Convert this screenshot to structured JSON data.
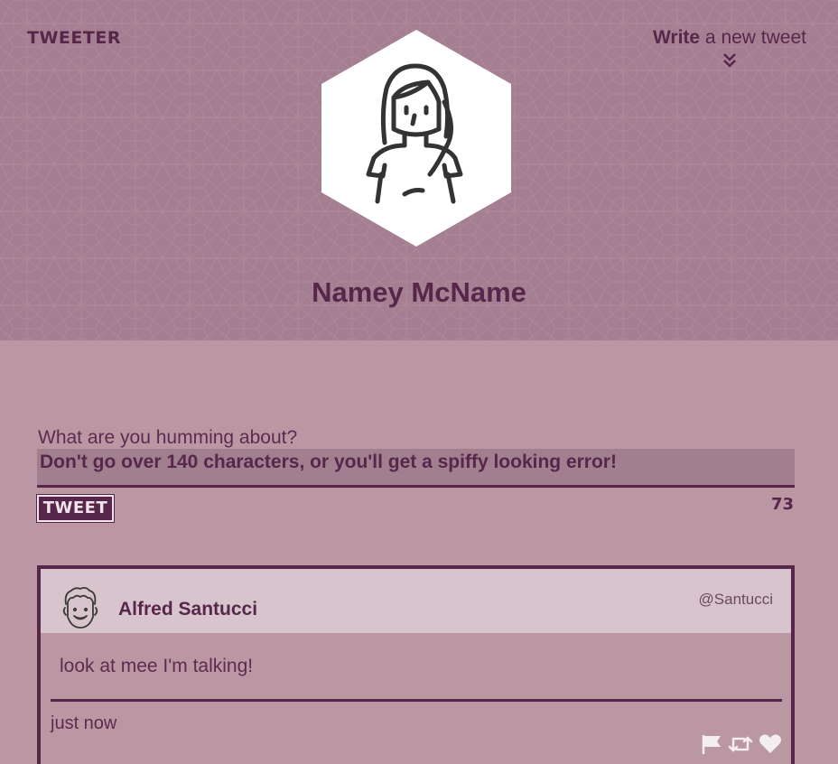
{
  "header": {
    "logo": "TWEETER",
    "write_link_bold": "Write",
    "write_link_rest": " a new tweet",
    "profile_name": "Namey McName"
  },
  "compose": {
    "label": "What are you humming about?",
    "value": "Don't go over 140 characters, or you'll get a spiffy looking error!",
    "button_label": "TWEET",
    "char_count": "73"
  },
  "tweets": [
    {
      "author": "Alfred Santucci",
      "handle": "@Santucci",
      "text": "look at mee I'm talking!",
      "time": "just now"
    }
  ],
  "icons": {
    "write_chevron": "double-chevron-down-icon",
    "flag": "flag-icon",
    "retweet": "retweet-icon",
    "like": "heart-icon"
  },
  "colors": {
    "primary": "#57274b",
    "header_bg": "#a47f91",
    "page_bg": "#bb96a3",
    "card_head_bg": "#d7c4cc",
    "action_icon": "#f5eef1"
  }
}
